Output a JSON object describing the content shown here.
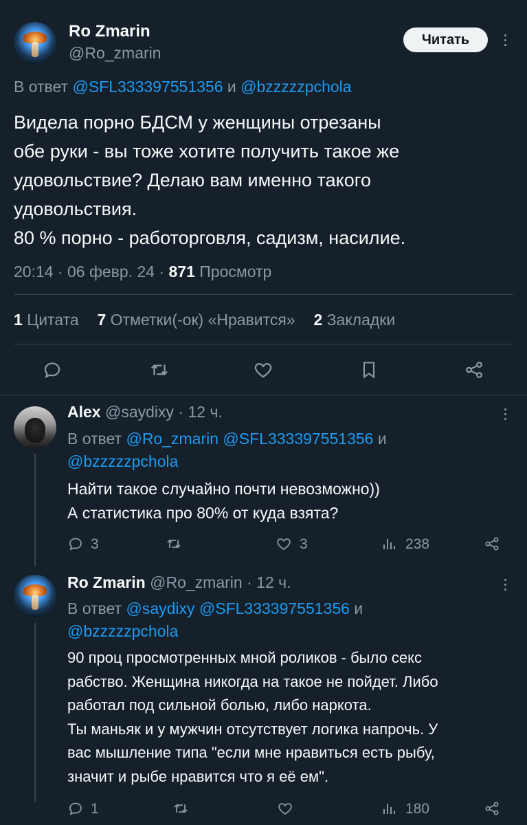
{
  "main": {
    "author_name": "Ro Zmarin",
    "author_handle": "@Ro_zmarin",
    "follow_label": "Читать",
    "reply_prefix": "В ответ",
    "reply_user1": "@SFL333397551356",
    "reply_and": "и",
    "reply_user2": "@bzzzzzpchola",
    "text_lines": [
      "Видела порно БДСМ у женщины отрезаны",
      "обе руки - вы тоже хотите получить такое же",
      "удовольствие? Делаю вам именно такого",
      "удовольствия.",
      "80 % порно - работорговля, садизм, насилие."
    ],
    "time": "20:14 · 06 февр. 24 ·",
    "views_count": "871",
    "views_label": "Просмотр",
    "quotes_count": "1",
    "quotes_label": "Цитата",
    "likes_count": "7",
    "likes_label": "Отметки(-ок) «Нравится»",
    "bookmarks_count": "2",
    "bookmarks_label": "Закладки"
  },
  "reply1": {
    "author_name": "Alex",
    "meta": "@saydixy · 12 ч.",
    "reply_prefix": "В ответ",
    "reply_user1": "@Ro_zmarin",
    "reply_user2": "@SFL333397551356",
    "reply_and": "и",
    "reply_user3": "@bzzzzzpchola",
    "text_lines": [
      "Найти такое случайно почти невозможно))",
      "А статистика про 80% от куда взята?"
    ],
    "reply_count": "3",
    "like_count": "3",
    "views": "238"
  },
  "reply2": {
    "author_name": "Ro Zmarin",
    "meta": "@Ro_zmarin · 12 ч.",
    "reply_prefix": "В ответ",
    "reply_user1": "@saydixy",
    "reply_user2": "@SFL333397551356",
    "reply_and": "и",
    "reply_user3": "@bzzzzzpchola",
    "text_lines": [
      "90 проц просмотренных мной роликов - было секс",
      "рабство. Женщина никогда на такое не пойдет. Либо",
      "работал под сильной болью, либо наркота.",
      "Ты маньяк и у мужчин отсутствует логика напрочь. У",
      "вас мышление типа \"если мне нравиться есть рыбу,",
      "значит и рыбе нравится что я её ем\"."
    ],
    "reply_count": "1",
    "views": "180"
  },
  "icons": {
    "reply": "reply-icon",
    "retweet": "retweet-icon",
    "like": "heart-icon",
    "bookmark": "bookmark-icon",
    "share": "share-icon",
    "views": "views-icon",
    "more": "more-icon"
  },
  "colors": {
    "background": "#15202b",
    "text": "#f7f9f9",
    "muted": "#8b98a5",
    "link": "#1d9bf0",
    "divider": "#38444d"
  }
}
